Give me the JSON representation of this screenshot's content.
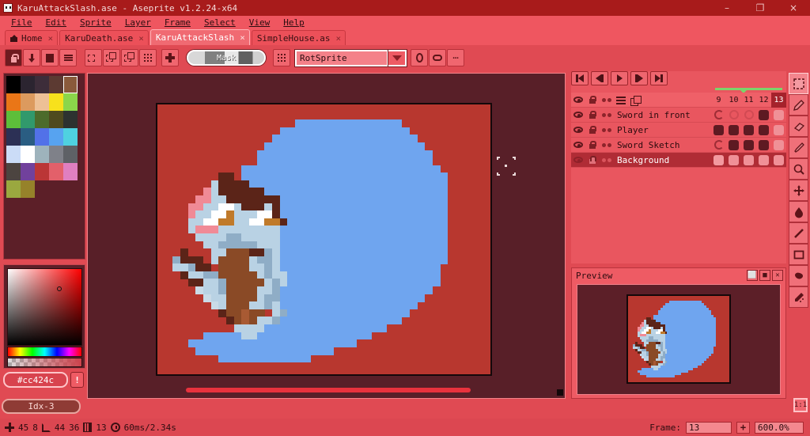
{
  "window": {
    "title": "KaruAttackSlash.ase - Aseprite v1.2.24-x64",
    "app_icon": "aseprite-icon",
    "minimize": "–",
    "maximize": "❐",
    "close": "×"
  },
  "menu": {
    "items": [
      "File",
      "Edit",
      "Sprite",
      "Layer",
      "Frame",
      "Select",
      "View",
      "Help"
    ]
  },
  "tabs": [
    {
      "label": "Home",
      "icon": "home-icon",
      "close": "×",
      "active": false
    },
    {
      "label": "KaruDeath.ase",
      "close": "×",
      "active": false
    },
    {
      "label": "KaruAttackSlash",
      "close": "×",
      "active": true
    },
    {
      "label": "SimpleHouse.as",
      "close": "×",
      "active": false
    }
  ],
  "context_toolbar": {
    "buttons": [
      {
        "name": "lock-pixel-ratio",
        "icon": "padlock-icon",
        "active": true
      },
      {
        "name": "snap-down",
        "icon": "arrow-down-icon"
      },
      {
        "name": "fill-selection",
        "icon": "filled-square-icon"
      },
      {
        "name": "options-menu",
        "icon": "hamburger-icon"
      },
      {
        "name": "replace-selection",
        "icon": "selection-replace-icon"
      },
      {
        "name": "add-selection",
        "icon": "selection-add-icon"
      },
      {
        "name": "subtract-selection",
        "icon": "selection-subtract-icon"
      },
      {
        "name": "intersect-selection",
        "icon": "selection-intersect-icon"
      },
      {
        "name": "magic-wand-refine",
        "icon": "sparkle-icon"
      }
    ],
    "mask_slider_label": "Mask",
    "pixel_perfect_icon": "dotted-grid-icon",
    "rotation_algorithm": "RotSprite",
    "rotation_dropdown_arrow": "▼",
    "extra_buttons": [
      {
        "name": "pivot-button",
        "icon": "pivot-icon"
      },
      {
        "name": "transform-button",
        "icon": "transform-icon"
      },
      {
        "name": "more-options-button",
        "icon": "ellipsis-icon",
        "label": "⋯"
      }
    ]
  },
  "palette": {
    "colors": [
      "#000000",
      "#2b2430",
      "#3d2d3a",
      "#5c3a32",
      "#8a5a3b",
      "#ea7617",
      "#dc9a5e",
      "#edc096",
      "#f7e11c",
      "#8bd64a",
      "#5dbe3a",
      "#31996c",
      "#4c6b2b",
      "#4f4a1e",
      "#2d3230",
      "#2c3055",
      "#2a5d82",
      "#5271e8",
      "#57a3f0",
      "#4fd1e0",
      "#cbdcf7",
      "#ffffff",
      "#9eb3bc",
      "#7f8189",
      "#5e6166",
      "#4c4440",
      "#71419c",
      "#bb3636",
      "#e3606a",
      "#e07fc0",
      "#9aa83f",
      "#96822a"
    ],
    "selected_swatch_index": 4,
    "fg_color": "#cc424c",
    "hex_value": "#cc424c",
    "warning_icon": "!",
    "index_label": "Idx-3"
  },
  "canvas": {
    "background_color": "#b8372f",
    "slash_color": "#6fa5ef",
    "brush_cursor": "brush-outline-cursor",
    "sprite_name": "cat character with sword slash"
  },
  "timeline": {
    "nav_buttons": [
      {
        "name": "go-to-first-frame",
        "icon": "skip-back-icon"
      },
      {
        "name": "go-to-previous-frame",
        "icon": "step-back-icon"
      },
      {
        "name": "play-animation",
        "icon": "play-icon"
      },
      {
        "name": "go-to-next-frame",
        "icon": "step-forward-icon"
      },
      {
        "name": "go-to-last-frame",
        "icon": "skip-forward-icon"
      }
    ],
    "tag_color": "#7dd36a",
    "frame_numbers": [
      "9",
      "10",
      "11",
      "12",
      "13"
    ],
    "current_frame": "13",
    "header_icons": [
      {
        "name": "layer-visibility-toggle",
        "icon": "eye-icon"
      },
      {
        "name": "layer-lock-toggle",
        "icon": "padlock-icon"
      },
      {
        "name": "layer-continuous-toggle",
        "icon": "two-dots-icon"
      },
      {
        "name": "layer-properties",
        "icon": "sliders-icon"
      },
      {
        "name": "new-layer",
        "icon": "copy-layer-icon"
      }
    ],
    "layers": [
      {
        "name": "Sword in front",
        "visible": true,
        "locked": false,
        "selected": false,
        "cels": [
          "open",
          "empty",
          "empty",
          "full",
          "bg"
        ]
      },
      {
        "name": "Player",
        "visible": true,
        "locked": false,
        "selected": false,
        "cels": [
          "full",
          "full",
          "full",
          "full",
          "bg"
        ]
      },
      {
        "name": "Sword Sketch",
        "visible": true,
        "locked": false,
        "selected": false,
        "cels": [
          "open",
          "full",
          "full",
          "full",
          "bg"
        ]
      },
      {
        "name": "Background",
        "visible": true,
        "locked": false,
        "selected": true,
        "cels": [
          "bgsel",
          "bg",
          "bg",
          "bg",
          "bg"
        ]
      }
    ]
  },
  "preview": {
    "title": "Preview",
    "buttons": [
      {
        "name": "fit-preview-button",
        "icon": "fit-screen-icon",
        "label": "⬜"
      },
      {
        "name": "maximize-preview-button",
        "icon": "maximize-icon",
        "label": "■"
      },
      {
        "name": "close-preview-button",
        "icon": "close-icon",
        "label": "✕"
      }
    ]
  },
  "tools": [
    {
      "name": "marquee-tool",
      "icon": "marquee-icon",
      "selected": false
    },
    {
      "name": "pencil-tool",
      "icon": "pencil-icon",
      "selected": false
    },
    {
      "name": "eraser-tool",
      "icon": "eraser-icon",
      "selected": false
    },
    {
      "name": "eyedropper-tool",
      "icon": "eyedropper-icon",
      "selected": false
    },
    {
      "name": "zoom-tool",
      "icon": "magnifier-icon",
      "selected": false
    },
    {
      "name": "move-tool",
      "icon": "move-arrows-icon",
      "selected": false
    },
    {
      "name": "blur-tool",
      "icon": "blur-drop-icon",
      "selected": false
    },
    {
      "name": "line-tool",
      "icon": "line-icon",
      "selected": false
    },
    {
      "name": "rectangle-tool",
      "icon": "rectangle-icon",
      "selected": false
    },
    {
      "name": "paint-bucket-tool",
      "icon": "paint-bucket-icon",
      "selected": false
    },
    {
      "name": "spray-tool",
      "icon": "spray-can-icon",
      "selected": false
    }
  ],
  "statusbar": {
    "cursor_icon": "crosshair-icon",
    "cursor_x": "45",
    "cursor_y": "8",
    "size_icon": "canvas-size-icon",
    "size_w": "44",
    "size_h": "36",
    "frame_icon": "film-icon",
    "frame_count": "13",
    "duration_icon": "clock-icon",
    "duration": "60ms/2.34s",
    "frame_label": "Frame:",
    "frame_value": "13",
    "frame_plus": "+",
    "zoom_value": "600.0%",
    "zoom_fit_label": "1:1"
  }
}
